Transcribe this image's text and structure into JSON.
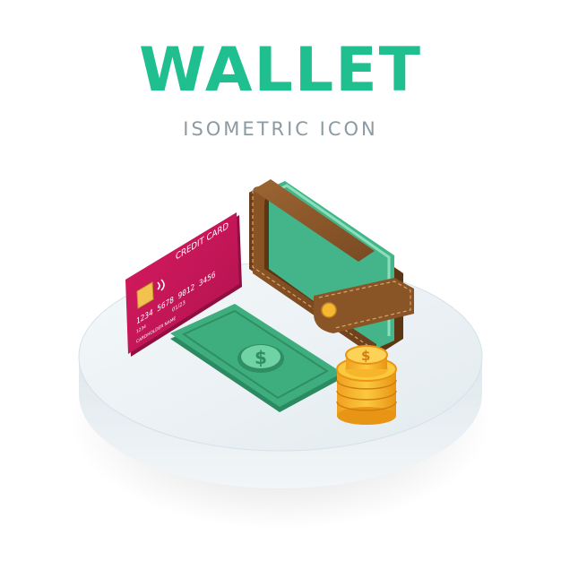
{
  "header": {
    "title": "WALLET",
    "subtitle": "ISOMETRIC ICON"
  },
  "card": {
    "label": "CREDIT CARD",
    "number_line": "1234 5678 9012 3456",
    "small_digits": "1234",
    "valid_thru": "01/23",
    "holder": "CARDHOLDER NAME"
  },
  "bill": {
    "symbol": "$"
  },
  "coins": {
    "symbol": "$"
  },
  "colors": {
    "title": "#1fbf8f",
    "subtitle": "#8c9aa3",
    "card": "#c2185b",
    "wallet": "#8b5a2b",
    "bill": "#3aa57a",
    "coin": "#f5b82e",
    "podium": "#e6eef2"
  },
  "icons": [
    "wallet-icon",
    "credit-card-icon",
    "dollar-bill-icon",
    "coin-stack-icon"
  ]
}
